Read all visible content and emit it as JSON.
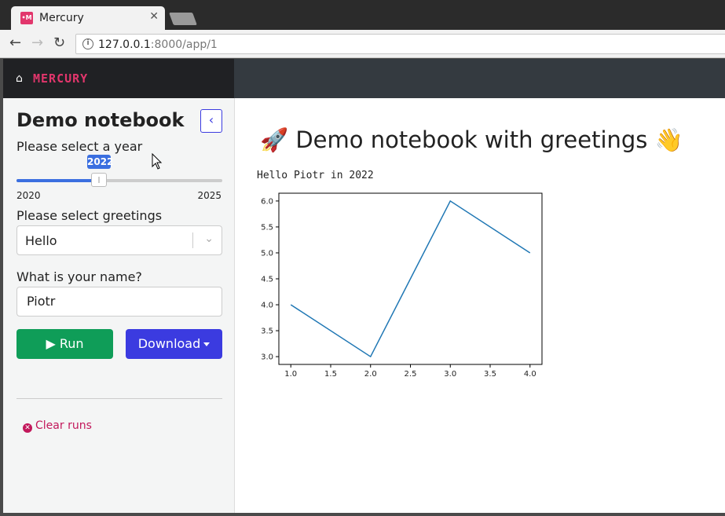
{
  "browser": {
    "tab_title": "Mercury",
    "favicon_text": "•M",
    "url_host": "127.0.0.1",
    "url_path": ":8000/app/1"
  },
  "navbar": {
    "brand": "MERCURY",
    "home_icon": "home-icon"
  },
  "sidebar": {
    "title": "Demo notebook",
    "year_label": "Please select a year",
    "year_slider": {
      "min": "2020",
      "max": "2025",
      "value": "2022"
    },
    "greetings_label": "Please select greetings",
    "greetings_value": "Hello",
    "name_label": "What is your name?",
    "name_value": "Piotr",
    "run_label": "Run",
    "download_label": "Download",
    "clear_runs_label": "Clear runs"
  },
  "main": {
    "title": "🚀 Demo notebook with greetings 👋",
    "greeting_output": "Hello Piotr in 2022"
  },
  "chart_data": {
    "type": "line",
    "x": [
      1.0,
      2.0,
      3.0,
      4.0
    ],
    "series": [
      {
        "values": [
          4.0,
          3.0,
          6.0,
          5.0
        ],
        "color": "#1f77b4"
      }
    ],
    "xticks": [
      "1.0",
      "1.5",
      "2.0",
      "2.5",
      "3.0",
      "3.5",
      "4.0"
    ],
    "yticks": [
      "3.0",
      "3.5",
      "4.0",
      "4.5",
      "5.0",
      "5.5",
      "6.0"
    ],
    "xlim": [
      0.85,
      4.15
    ],
    "ylim": [
      2.85,
      6.15
    ],
    "grid": false
  }
}
